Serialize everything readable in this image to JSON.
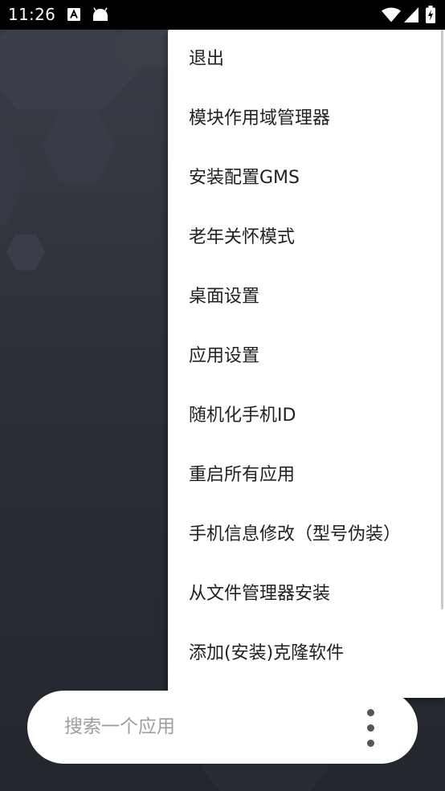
{
  "status_bar": {
    "time": "11:26",
    "left_icons": [
      "a-notification-icon",
      "android-icon"
    ],
    "right_icons": [
      "wifi-icon",
      "signal-icon",
      "battery-charging-icon"
    ]
  },
  "menu": {
    "items": [
      {
        "label": "退出"
      },
      {
        "label": "模块作用域管理器"
      },
      {
        "label": "安装配置GMS"
      },
      {
        "label": "老年关怀模式"
      },
      {
        "label": "桌面设置"
      },
      {
        "label": "应用设置"
      },
      {
        "label": "随机化手机ID"
      },
      {
        "label": "重启所有应用"
      },
      {
        "label": "手机信息修改（型号伪装）"
      },
      {
        "label": "从文件管理器安装"
      },
      {
        "label": "添加(安装)克隆软件"
      }
    ]
  },
  "search": {
    "placeholder": "搜索一个应用",
    "more_icon": "more-vertical-icon"
  },
  "colors": {
    "background": "#2b2d36",
    "menu_background": "#ffffff",
    "menu_text": "#212121",
    "placeholder_text": "#9e9e9e"
  }
}
